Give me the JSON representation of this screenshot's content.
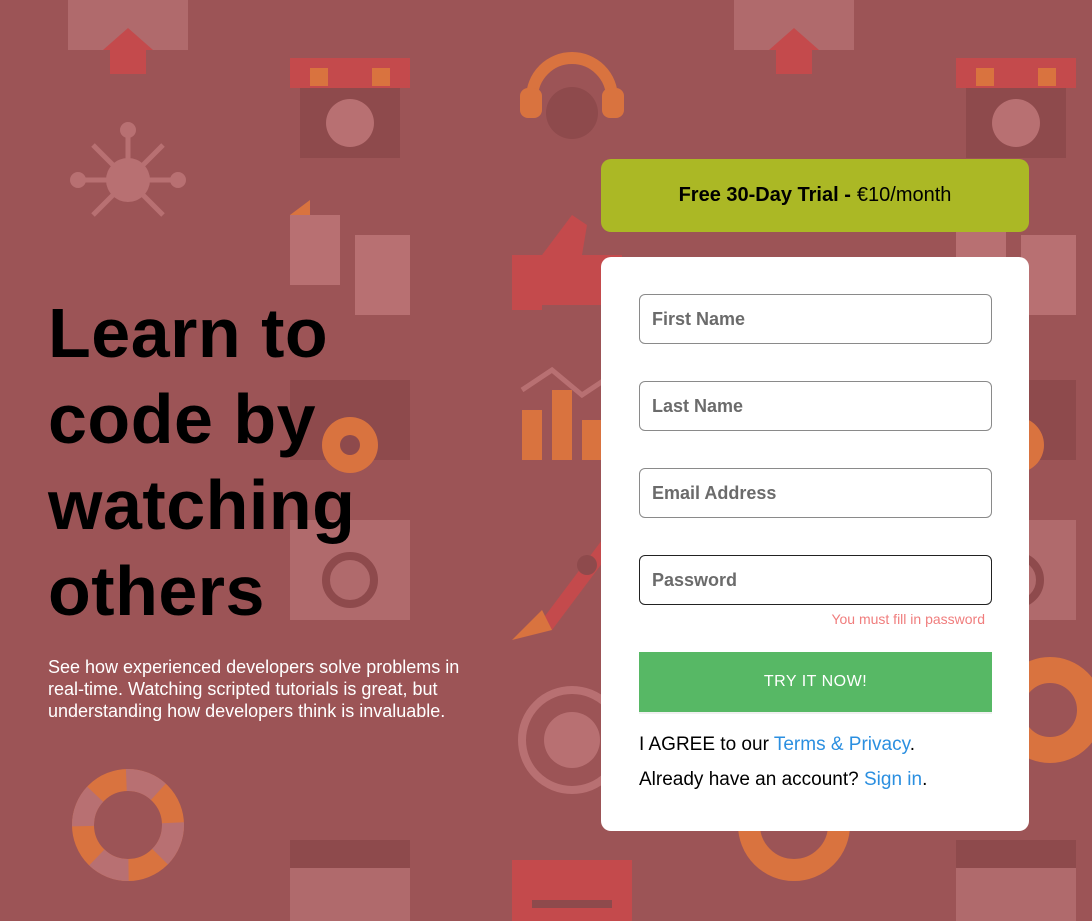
{
  "hero": {
    "title": "Learn to code by watching others",
    "subtitle": "See how experienced developers solve problems in real-time. Watching scripted tutorials is great, but understanding how developers think is invaluable."
  },
  "trial": {
    "bold_text": "Free 30-Day Trial -",
    "price_text": "€10/month"
  },
  "form": {
    "first_name_placeholder": "First Name",
    "last_name_placeholder": "Last Name",
    "email_placeholder": "Email Address",
    "password_placeholder": "Password",
    "password_error": "You must fill in password",
    "submit_label": "TRY IT NOW!",
    "agree_prefix": "I AGREE to our",
    "terms_link": "Terms & Privacy",
    "agree_suffix": ".",
    "signin_prefix": "Already have an account?",
    "signin_link": "Sign in",
    "signin_suffix": "."
  },
  "colors": {
    "background": "#9c5456",
    "trial_banner": "#abb825",
    "submit_button": "#57b865",
    "link": "#2b8fe0",
    "error": "#f07d7d"
  }
}
